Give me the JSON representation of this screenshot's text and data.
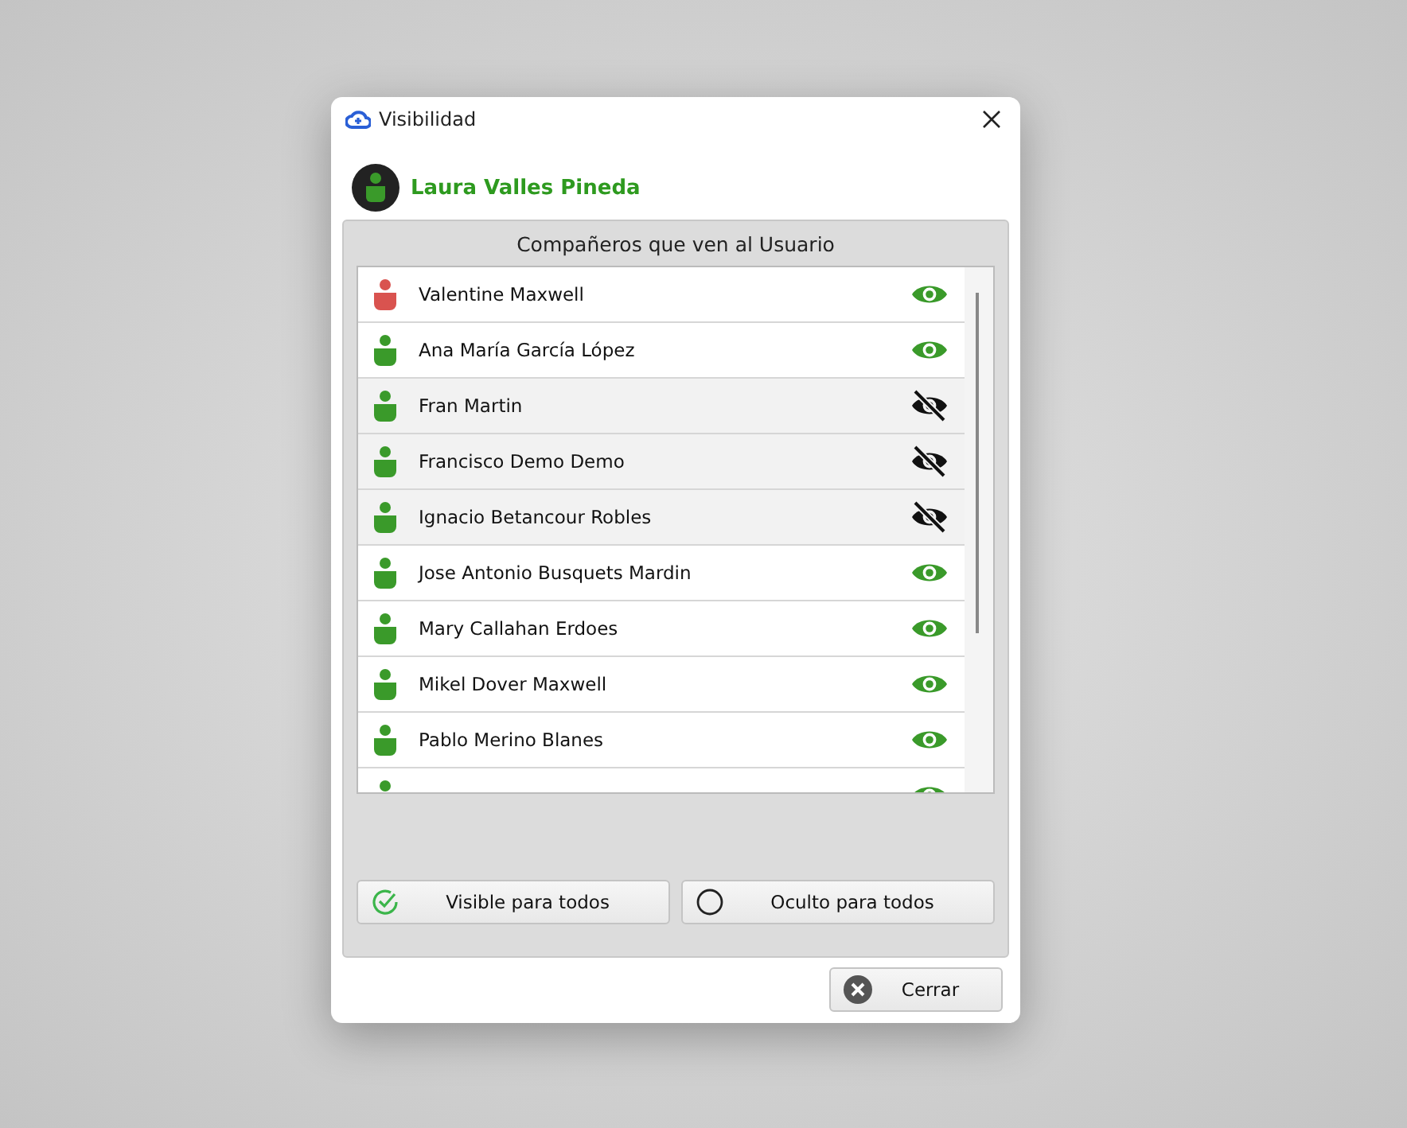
{
  "window": {
    "title": "Visibilidad"
  },
  "user": {
    "name": "Laura Valles Pineda"
  },
  "panel": {
    "title": "Compañeros que ven al Usuario"
  },
  "companions": [
    {
      "name": "Valentine Maxwell",
      "color": "#d9534f",
      "visible": true
    },
    {
      "name": "Ana María García López",
      "color": "#3a9a2a",
      "visible": true
    },
    {
      "name": "Fran Martin",
      "color": "#3a9a2a",
      "visible": false
    },
    {
      "name": "Francisco Demo Demo",
      "color": "#3a9a2a",
      "visible": false
    },
    {
      "name": "Ignacio Betancour Robles",
      "color": "#3a9a2a",
      "visible": false
    },
    {
      "name": "Jose Antonio Busquets Mardin",
      "color": "#3a9a2a",
      "visible": true
    },
    {
      "name": "Mary Callahan Erdoes",
      "color": "#3a9a2a",
      "visible": true
    },
    {
      "name": "Mikel Dover Maxwell",
      "color": "#3a9a2a",
      "visible": true
    },
    {
      "name": "Pablo Merino Blanes",
      "color": "#3a9a2a",
      "visible": true
    },
    {
      "color": "#3a9a2a",
      "visible": true
    }
  ],
  "buttons": [
    {
      "label": "Visible para todos",
      "kind": "check"
    },
    {
      "label": "Oculto para todos",
      "kind": "circle"
    }
  ],
  "close_button": {
    "label": "Cerrar"
  }
}
